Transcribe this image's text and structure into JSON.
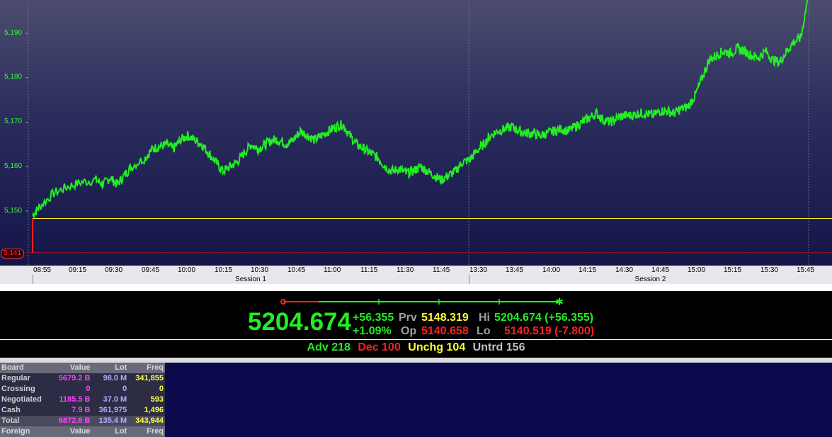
{
  "chart": {
    "y_ticks": [
      "5,190",
      "5,180",
      "5,170",
      "5,160",
      "5,150"
    ],
    "y_range": [
      5139,
      5197
    ],
    "prev_close_label": "5,141",
    "open_level": 5148.319,
    "prev_close_level": 5140.658,
    "time_labels": [
      "08:55",
      "09:15",
      "09:30",
      "09:45",
      "10:00",
      "10:15",
      "10:30",
      "10:45",
      "11:00",
      "11:15",
      "11:30",
      "11:45",
      "13:30",
      "13:45",
      "14:00",
      "14:15",
      "14:30",
      "14:45",
      "15:00",
      "15:15",
      "15:30",
      "15:45"
    ],
    "sessions": [
      "Session 1",
      "Session 2"
    ],
    "line_color": "#22ee22",
    "series": [
      [
        0,
        5149
      ],
      [
        1,
        5151
      ],
      [
        3,
        5154
      ],
      [
        5,
        5155.5
      ],
      [
        7,
        5156.5
      ],
      [
        9,
        5157
      ],
      [
        10,
        5156
      ],
      [
        11,
        5157.5
      ],
      [
        12,
        5156
      ],
      [
        13,
        5158
      ],
      [
        14,
        5160
      ],
      [
        16,
        5162
      ],
      [
        17,
        5164
      ],
      [
        18,
        5164.5
      ],
      [
        19,
        5165
      ],
      [
        20,
        5164
      ],
      [
        21,
        5166
      ],
      [
        22,
        5167
      ],
      [
        23,
        5166
      ],
      [
        24,
        5165
      ],
      [
        25,
        5163
      ],
      [
        26,
        5161
      ],
      [
        27,
        5159
      ],
      [
        28,
        5160
      ],
      [
        29,
        5161
      ],
      [
        30,
        5163
      ],
      [
        31,
        5165
      ],
      [
        32,
        5164
      ],
      [
        33,
        5165
      ],
      [
        34,
        5166
      ],
      [
        35,
        5166
      ],
      [
        36,
        5165
      ],
      [
        37,
        5166
      ],
      [
        38,
        5168
      ],
      [
        39,
        5167
      ],
      [
        40,
        5166
      ],
      [
        41,
        5167
      ],
      [
        42,
        5168
      ],
      [
        43,
        5169
      ],
      [
        44,
        5169.5
      ],
      [
        45,
        5167
      ],
      [
        46,
        5165
      ],
      [
        47,
        5164
      ],
      [
        48,
        5163
      ],
      [
        49,
        5162
      ],
      [
        50,
        5160
      ],
      [
        51,
        5159
      ],
      [
        52,
        5159.5
      ],
      [
        53,
        5158.5
      ],
      [
        54,
        5159
      ],
      [
        55,
        5160
      ],
      [
        56,
        5159
      ],
      [
        57,
        5158
      ],
      [
        58,
        5157
      ],
      [
        59,
        5158
      ],
      [
        60,
        5159
      ],
      [
        61,
        5161
      ],
      [
        62,
        5161.5
      ],
      [
        63,
        5163.5
      ],
      [
        64,
        5165
      ],
      [
        65,
        5167
      ],
      [
        66,
        5168
      ],
      [
        67,
        5168.5
      ],
      [
        68,
        5169
      ],
      [
        69,
        5168
      ],
      [
        70,
        5167.5
      ],
      [
        71,
        5167.5
      ],
      [
        72,
        5167
      ],
      [
        73,
        5167.5
      ],
      [
        74,
        5168
      ],
      [
        75,
        5168.5
      ],
      [
        76,
        5168
      ],
      [
        77,
        5169
      ],
      [
        78,
        5170
      ],
      [
        79,
        5171
      ],
      [
        80,
        5172
      ],
      [
        81,
        5170.5
      ],
      [
        82,
        5170
      ],
      [
        83,
        5171
      ],
      [
        84,
        5171.5
      ],
      [
        85,
        5171.5
      ],
      [
        86,
        5172
      ],
      [
        87,
        5172
      ],
      [
        88,
        5171.5
      ],
      [
        89,
        5172.5
      ],
      [
        90,
        5172.5
      ],
      [
        91,
        5172
      ],
      [
        92,
        5173
      ],
      [
        93,
        5173.5
      ],
      [
        94,
        5176
      ],
      [
        95,
        5180
      ],
      [
        96,
        5184
      ],
      [
        97,
        5185
      ],
      [
        98,
        5186
      ],
      [
        99,
        5185.5
      ],
      [
        100,
        5186.5
      ],
      [
        101,
        5186
      ],
      [
        102,
        5185
      ],
      [
        103,
        5184.5
      ],
      [
        104,
        5186
      ],
      [
        105,
        5184
      ],
      [
        106,
        5183.5
      ],
      [
        107,
        5186
      ],
      [
        108,
        5188
      ],
      [
        109,
        5189
      ],
      [
        110,
        5198
      ]
    ]
  },
  "summary": {
    "last": "5204.674",
    "chg": "+56.355",
    "chg_pct": "+1.09%",
    "prv_label": "Prv",
    "prv": "5148.319",
    "op_label": "Op",
    "op": "5140.658",
    "hi_label": "Hi",
    "hi": "5204.674 (+56.355)",
    "lo_label": "Lo",
    "lo": "5140.519 (-7.800)",
    "range_position": 1.0,
    "range_ticks": 3
  },
  "breadth": {
    "adv": "Adv 218",
    "dec": "Dec 100",
    "unchg": "Unchg 104",
    "untrd": "Untrd 156"
  },
  "board": {
    "headers": [
      "Board",
      "Value",
      "Lot",
      "Freq"
    ],
    "rows": [
      [
        "Regular",
        "5679.2 B",
        "98.0 M",
        "341,855"
      ],
      [
        "Crossing",
        "0",
        "0",
        "0"
      ],
      [
        "Negotiated",
        "1185.5 B",
        "37.0 M",
        "593"
      ],
      [
        "Cash",
        "7.9 B",
        "361,975",
        "1,496"
      ],
      [
        "Total",
        "6872.6 B",
        "135.4 M",
        "343,944"
      ]
    ],
    "foreign_headers": [
      "Foreign",
      "Value",
      "Lot",
      "Freq"
    ]
  },
  "colors": {
    "up": "#22ee22",
    "down": "#ff2020",
    "flat": "#ffff33",
    "untraded": "#c0c0c0"
  }
}
